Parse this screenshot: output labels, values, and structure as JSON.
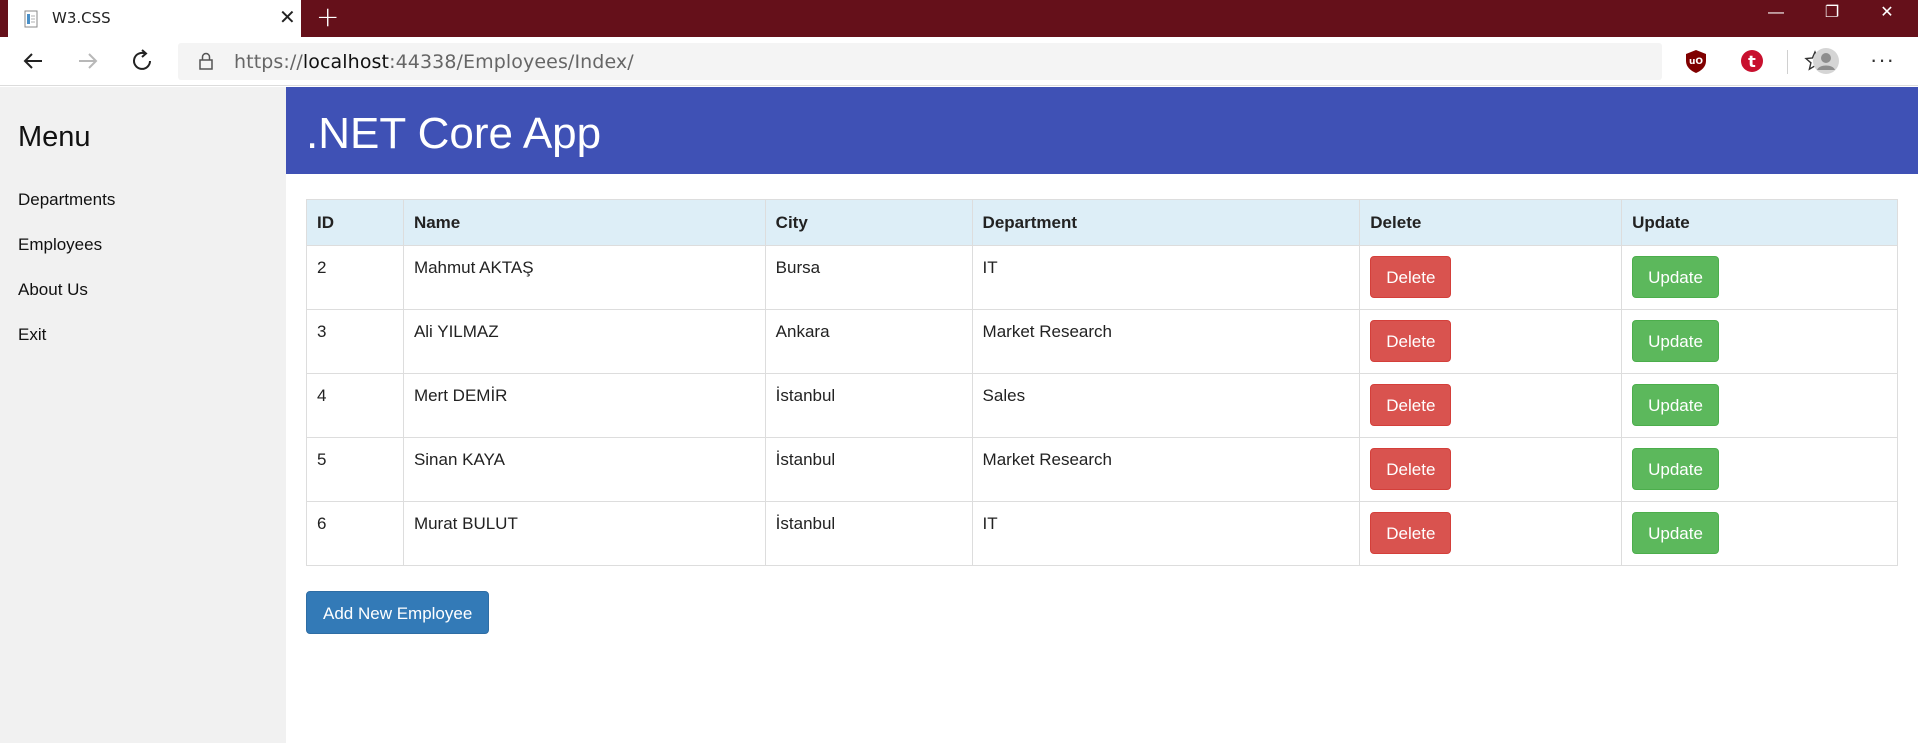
{
  "browser": {
    "tab_title": "W3.CSS",
    "tab_close": "✕",
    "new_tab": "+",
    "url_prefix": "https://",
    "url_host": "localhost",
    "url_rest": ":44338/Employees/Index/",
    "window_minimize": "—",
    "window_restore": "❐",
    "window_close": "✕",
    "more_menu": "···"
  },
  "sidebar": {
    "title": "Menu",
    "items": [
      {
        "label": "Departments"
      },
      {
        "label": "Employees"
      },
      {
        "label": "About Us"
      },
      {
        "label": "Exit"
      }
    ]
  },
  "header": {
    "title": ".NET Core App"
  },
  "table": {
    "columns": [
      "ID",
      "Name",
      "City",
      "Department",
      "Delete",
      "Update"
    ],
    "rows": [
      {
        "id": "2",
        "name": "Mahmut AKTAŞ",
        "city": "Bursa",
        "department": "IT"
      },
      {
        "id": "3",
        "name": "Ali YILMAZ",
        "city": "Ankara",
        "department": "Market Research"
      },
      {
        "id": "4",
        "name": "Mert DEMİR",
        "city": "İstanbul",
        "department": "Sales"
      },
      {
        "id": "5",
        "name": "Sinan KAYA",
        "city": "İstanbul",
        "department": "Market Research"
      },
      {
        "id": "6",
        "name": "Murat BULUT",
        "city": "İstanbul",
        "department": "IT"
      }
    ],
    "delete_label": "Delete",
    "update_label": "Update"
  },
  "add_button": {
    "label": "Add New Employee"
  },
  "colors": {
    "titlebar": "#65101a",
    "header": "#3f51b5",
    "sidebar": "#f1f1f1",
    "table_header": "#ddeef7",
    "delete": "#d9534f",
    "update": "#5cb85c",
    "add": "#337ab7"
  },
  "icons": [
    "page-icon",
    "back-arrow-icon",
    "forward-arrow-icon",
    "refresh-icon",
    "lock-icon",
    "star-icon",
    "ublock-icon",
    "t-extension-icon",
    "profile-avatar-icon"
  ]
}
